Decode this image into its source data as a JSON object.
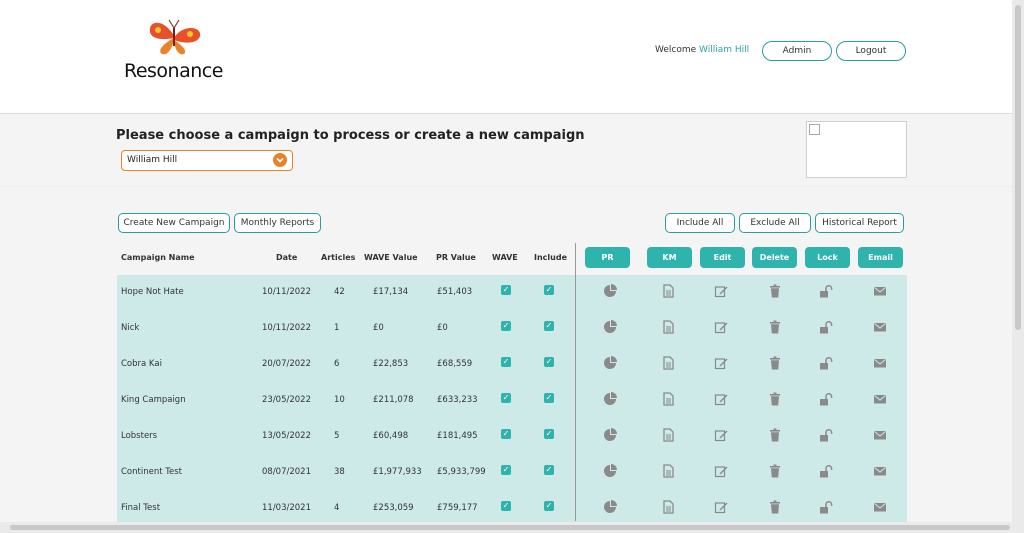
{
  "app": {
    "logo_text": "Resonance"
  },
  "header": {
    "welcome_prefix": "Welcome",
    "user_name": "William Hill",
    "admin_label": "Admin",
    "logout_label": "Logout"
  },
  "chooser": {
    "title": "Please choose a campaign to process or create a new campaign",
    "selected_campaign": "William Hill"
  },
  "toolbar": {
    "create_label": "Create New Campaign",
    "monthly_label": "Monthly Reports",
    "include_all_label": "Include All",
    "exclude_all_label": "Exclude All",
    "historical_label": "Historical Report"
  },
  "table": {
    "columns": [
      "Campaign Name",
      "Date",
      "Articles",
      "WAVE Value",
      "PR Value",
      "WAVE",
      "Include"
    ],
    "actions": [
      "PR Report",
      "KM",
      "Edit",
      "Delete",
      "Lock",
      "Email"
    ],
    "rows": [
      {
        "name": "Hope Not Hate",
        "date": "10/11/2022",
        "articles": "42",
        "wave_value": "£17,134",
        "pr_value": "£51,403",
        "wave": true,
        "include": true
      },
      {
        "name": "Nick",
        "date": "10/11/2022",
        "articles": "1",
        "wave_value": "£0",
        "pr_value": "£0",
        "wave": true,
        "include": true
      },
      {
        "name": "Cobra Kai",
        "date": "20/07/2022",
        "articles": "6",
        "wave_value": "£22,853",
        "pr_value": "£68,559",
        "wave": true,
        "include": true
      },
      {
        "name": "King Campaign",
        "date": "23/05/2022",
        "articles": "10",
        "wave_value": "£211,078",
        "pr_value": "£633,233",
        "wave": true,
        "include": true
      },
      {
        "name": "Lobsters",
        "date": "13/05/2022",
        "articles": "5",
        "wave_value": "£60,498",
        "pr_value": "£181,495",
        "wave": true,
        "include": true
      },
      {
        "name": "Continent Test",
        "date": "08/07/2021",
        "articles": "38",
        "wave_value": "£1,977,933",
        "pr_value": "£5,933,799",
        "wave": true,
        "include": true
      },
      {
        "name": "Final Test",
        "date": "11/03/2021",
        "articles": "4",
        "wave_value": "£253,059",
        "pr_value": "£759,177",
        "wave": true,
        "include": true
      }
    ]
  },
  "colors": {
    "accent": "#2fb3ad",
    "orange": "#e8832a",
    "table_bg": "#cdeae9"
  },
  "icons": [
    "pie-chart-icon",
    "document-icon",
    "edit-icon",
    "trash-icon",
    "unlock-icon",
    "envelope-icon"
  ]
}
